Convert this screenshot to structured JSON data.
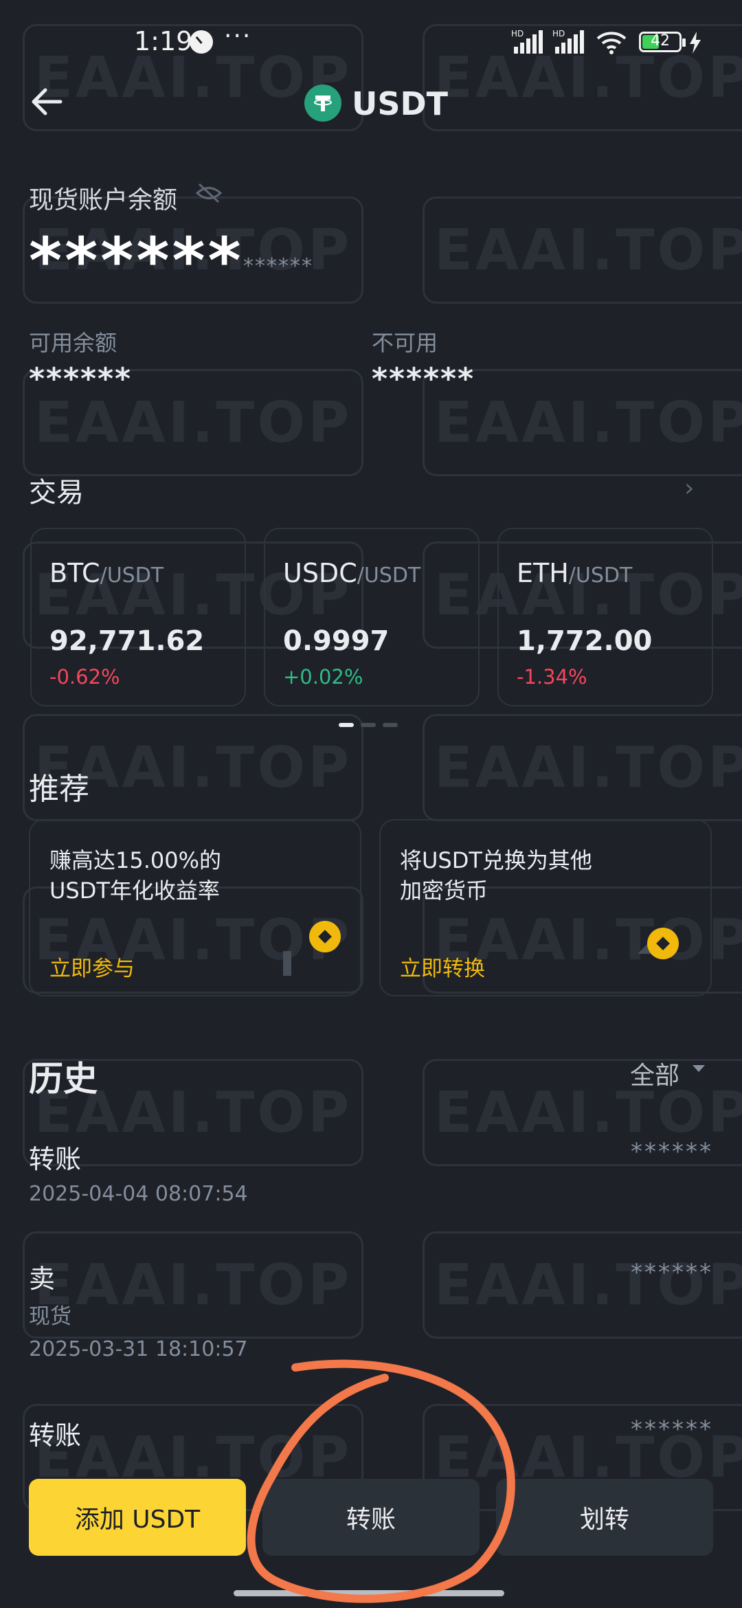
{
  "status_bar": {
    "time": "1:19",
    "dots": "···",
    "signal1": "HD",
    "signal2": "HD",
    "battery": "42"
  },
  "header": {
    "title": "USDT",
    "coin_icon": "tether-icon",
    "back_icon": "arrow-left-icon"
  },
  "balance": {
    "label": "现货账户余额",
    "value": "******",
    "secondary": "******",
    "available_label": "可用余额",
    "available_value": "******",
    "unavailable_label": "不可用",
    "unavailable_value": "******"
  },
  "trade": {
    "title": "交易",
    "pairs": [
      {
        "base": "BTC",
        "quote": "/USDT",
        "price": "92,771.62",
        "change": "-0.62%"
      },
      {
        "base": "USDC",
        "quote": "/USDT",
        "price": "0.9997",
        "change": "+0.02%"
      },
      {
        "base": "ETH",
        "quote": "/USDT",
        "price": "1,772.00",
        "change": "-1.34%"
      }
    ]
  },
  "recommend": {
    "title": "推荐",
    "cards": [
      {
        "line1": "赚高达15.00%的",
        "line2": "USDT年化收益率",
        "link": "立即参与"
      },
      {
        "line1": "将USDT兑换为其他",
        "line2": "加密货币",
        "link": "立即转换"
      }
    ]
  },
  "history": {
    "title": "历史",
    "filter": "全部",
    "items": [
      {
        "type": "转账",
        "sub": "",
        "date": "2025-04-04 08:07:54",
        "amount": "******"
      },
      {
        "type": "卖",
        "sub": "现货",
        "date": "2025-03-31 18:10:57",
        "amount": "******"
      },
      {
        "type": "转账",
        "sub": "",
        "date": "",
        "amount": "******"
      }
    ]
  },
  "actions": {
    "add": "添加 USDT",
    "transfer": "转账",
    "move": "划转"
  },
  "watermark": "EAAI.TOP",
  "colors": {
    "background": "#1e2128",
    "primary": "#fcd535",
    "negative": "#f6465d",
    "positive": "#2ebd85",
    "annotation": "#f3784a"
  }
}
